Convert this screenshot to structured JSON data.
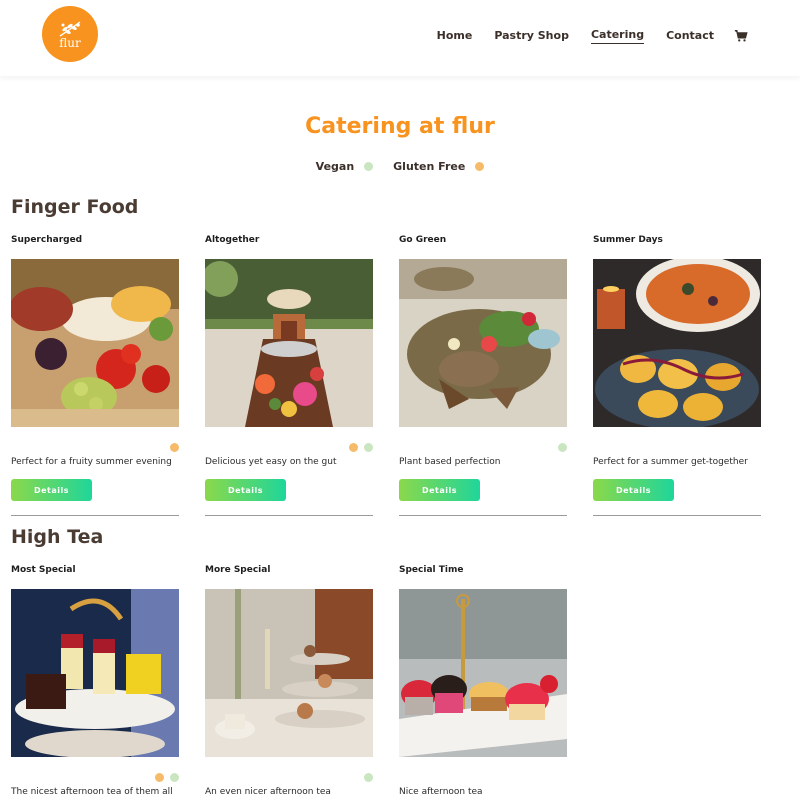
{
  "header": {
    "logo_text": "flur",
    "nav": [
      {
        "label": "Home",
        "active": false
      },
      {
        "label": "Pastry Shop",
        "active": false
      },
      {
        "label": "Catering",
        "active": true
      },
      {
        "label": "Contact",
        "active": false
      }
    ],
    "cart_icon": "shopping-cart-icon"
  },
  "page": {
    "title": "Catering at flur",
    "legend": [
      {
        "label": "Vegan",
        "color": "#c9e6c0"
      },
      {
        "label": "Gluten Free",
        "color": "#f5bb6a"
      }
    ]
  },
  "colors": {
    "brand_orange": "#f7931e",
    "vegan_green": "#c9e6c0",
    "gluten_free_orange": "#f5bb6a",
    "button_gradient_start": "#8bd84a",
    "button_gradient_end": "#1fd69a"
  },
  "sections": [
    {
      "title": "Finger Food",
      "items": [
        {
          "name": "Supercharged",
          "desc": "Perfect for a fruity summer evening",
          "vegan": false,
          "gluten_free": true,
          "button": "Details",
          "image": "charcuterie-board-photo"
        },
        {
          "name": "Altogether",
          "desc": "Delicious yet easy on the gut",
          "vegan": true,
          "gluten_free": true,
          "button": "Details",
          "image": "long-table-grazing-photo"
        },
        {
          "name": "Go Green",
          "desc": "Plant based perfection",
          "vegan": true,
          "gluten_free": false,
          "button": "Details",
          "image": "vegan-platter-photo"
        },
        {
          "name": "Summer Days",
          "desc": "Perfect for a summer get-together",
          "vegan": false,
          "gluten_free": false,
          "button": "Details",
          "image": "roasted-potatoes-photo"
        }
      ]
    },
    {
      "title": "High Tea",
      "items": [
        {
          "name": "Most Special",
          "desc": "The nicest afternoon tea of them all",
          "vegan": true,
          "gluten_free": true,
          "image": "dessert-stand-photo"
        },
        {
          "name": "More Special",
          "desc": "An even nicer afternoon tea",
          "vegan": true,
          "gluten_free": false,
          "image": "tiered-tea-photo"
        },
        {
          "name": "Special Time",
          "desc": "Nice afternoon tea",
          "vegan": false,
          "gluten_free": false,
          "image": "cupcakes-tray-photo"
        }
      ]
    }
  ]
}
